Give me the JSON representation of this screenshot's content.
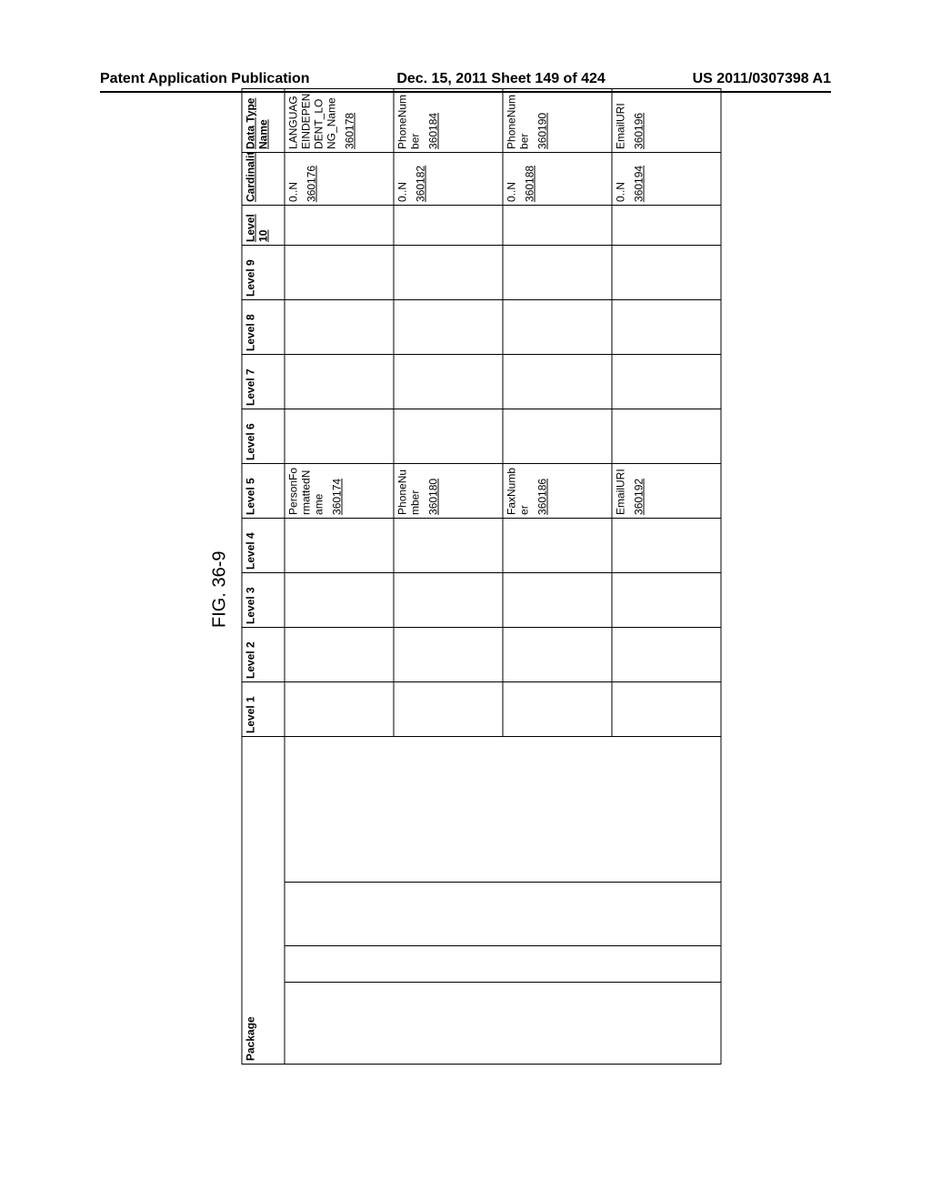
{
  "header": {
    "left": "Patent Application Publication",
    "mid": "Dec. 15, 2011  Sheet 149 of 424",
    "right": "US 2011/0307398 A1"
  },
  "figure_label": "FIG. 36-9",
  "columns": {
    "package": "Package",
    "level1": "Level 1",
    "level2": "Level 2",
    "level3": "Level 3",
    "level4": "Level 4",
    "level5": "Level 5",
    "level6": "Level 6",
    "level7": "Level 7",
    "level8": "Level 8",
    "level9": "Level 9",
    "level10": "Level 10",
    "cardinality": "Cardinality",
    "data_type_name": "Data Type Name"
  },
  "rows": [
    {
      "level5": "PersonFormattedName",
      "level5_id": "360174",
      "cardinality": "0..N",
      "cardinality_id": "360176",
      "data_type_name": "LANGUAGEINDEPENDENT_LONG_Name",
      "data_type_id": "360178"
    },
    {
      "level5": "PhoneNumber",
      "level5_id": "360180",
      "cardinality": "0..N",
      "cardinality_id": "360182",
      "data_type_name": "PhoneNumber",
      "data_type_id": "360184"
    },
    {
      "level5": "FaxNumber",
      "level5_id": "360186",
      "cardinality": "0..N",
      "cardinality_id": "360188",
      "data_type_name": "PhoneNumber",
      "data_type_id": "360190"
    },
    {
      "level5": "EmailURI",
      "level5_id": "360192",
      "cardinality": "0..N",
      "cardinality_id": "360194",
      "data_type_name": "EmailURI",
      "data_type_id": "360196"
    }
  ]
}
